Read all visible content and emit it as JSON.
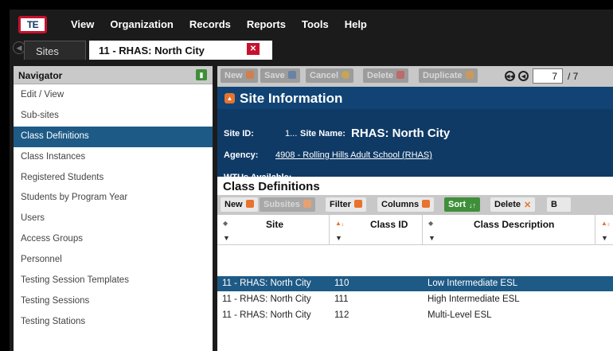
{
  "app": {
    "logo_text": "TE",
    "menu": [
      "View",
      "Organization",
      "Records",
      "Reports",
      "Tools",
      "Help"
    ]
  },
  "tabs": {
    "sites": "Sites",
    "active": "11 - RHAS: North City"
  },
  "navigator": {
    "title": "Navigator",
    "items": [
      "Edit / View",
      "Sub-sites",
      "Class Definitions",
      "Class Instances",
      "Registered Students",
      "Students by Program Year",
      "Users",
      "Access Groups",
      "Personnel",
      "Testing Session Templates",
      "Testing Sessions",
      "Testing Stations"
    ],
    "active_index": 2
  },
  "toolbar": {
    "new": "New",
    "save": "Save",
    "cancel": "Cancel",
    "delete": "Delete",
    "duplicate": "Duplicate",
    "record_value": "7",
    "record_total": "/ 7"
  },
  "site_info": {
    "title": "Site Information",
    "site_id_label": "Site ID:",
    "site_id_value": "1...",
    "site_name_label": "Site Name:",
    "site_name_value": "RHAS: North City",
    "agency_label": "Agency:",
    "agency_value": "4908 - Rolling Hills Adult School (RHAS)",
    "wtus_label": "WTUs Available:"
  },
  "class_definitions": {
    "title": "Class Definitions",
    "buttons": {
      "new": "New",
      "subsites": "Subsites",
      "filter": "Filter",
      "columns": "Columns",
      "sort": "Sort",
      "delete": "Delete",
      "more": "B"
    },
    "columns": [
      "Site",
      "Class ID",
      "Class Description"
    ],
    "rows": [
      {
        "site": "11 - RHAS: North City",
        "class_id": "110",
        "description": "Low Intermediate ESL"
      },
      {
        "site": "11 - RHAS: North City",
        "class_id": "111",
        "description": "High Intermediate ESL"
      },
      {
        "site": "11 - RHAS: North City",
        "class_id": "112",
        "description": "Multi-Level ESL"
      }
    ],
    "selected_row": 0
  },
  "colors": {
    "accent_blue": "#1e5a86",
    "header_navy": "#0f3a66",
    "brand_red": "#c8102e",
    "green": "#3f8f3a",
    "orange": "#e8732e"
  }
}
